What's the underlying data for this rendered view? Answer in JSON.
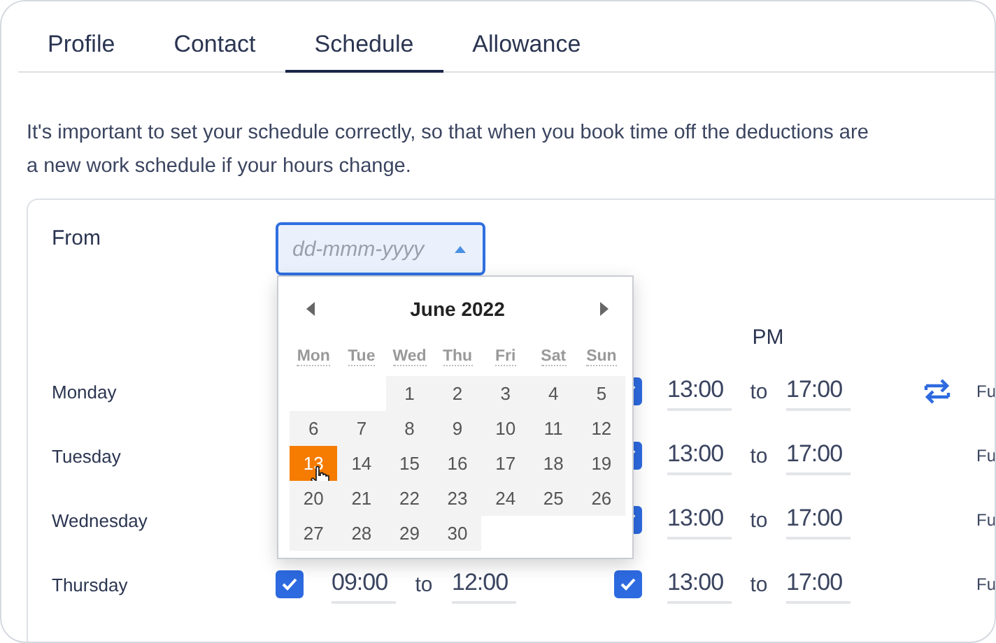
{
  "tabs": [
    {
      "label": "Profile",
      "selected": false
    },
    {
      "label": "Contact",
      "selected": false
    },
    {
      "label": "Schedule",
      "selected": true
    },
    {
      "label": "Allowance",
      "selected": false
    }
  ],
  "intro": [
    "It's important to set your schedule correctly, so that when you book time off the deductions are",
    "a new work schedule if your hours change."
  ],
  "from": {
    "label": "From",
    "placeholder": "dd-mmm-yyyy",
    "open": true
  },
  "pm_heading": "PM",
  "rows": [
    {
      "day": "Monday",
      "pm": {
        "checked": true,
        "from": "13:00",
        "sep": "to",
        "to": "17:00"
      },
      "repeat": true,
      "column_extra": "Fu"
    },
    {
      "day": "Tuesday",
      "pm": {
        "checked": true,
        "from": "13:00",
        "sep": "to",
        "to": "17:00"
      },
      "repeat": false,
      "column_extra": "Fu"
    },
    {
      "day": "Wednesday",
      "pm": {
        "checked": true,
        "from": "13:00",
        "sep": "to",
        "to": "17:00"
      },
      "repeat": false,
      "column_extra": "Fu"
    },
    {
      "day": "Thursday",
      "am": {
        "checked": true,
        "from": "09:00",
        "sep": "to",
        "to": "12:00"
      },
      "pm": {
        "checked": true,
        "from": "13:00",
        "sep": "to",
        "to": "17:00"
      },
      "repeat": false,
      "column_extra": "Fu"
    }
  ],
  "calendar": {
    "title": "June 2022",
    "weekdays": [
      "Mon",
      "Tue",
      "Wed",
      "Thu",
      "Fri",
      "Sat",
      "Sun"
    ],
    "days": [
      {
        "kind": "blank"
      },
      {
        "kind": "blank"
      },
      {
        "kind": "day",
        "label": "1",
        "selected": false
      },
      {
        "kind": "day",
        "label": "2",
        "selected": false
      },
      {
        "kind": "day",
        "label": "3",
        "selected": false
      },
      {
        "kind": "day",
        "label": "4",
        "selected": false
      },
      {
        "kind": "day",
        "label": "5",
        "selected": false
      },
      {
        "kind": "day",
        "label": "6",
        "selected": false
      },
      {
        "kind": "day",
        "label": "7",
        "selected": false
      },
      {
        "kind": "day",
        "label": "8",
        "selected": false
      },
      {
        "kind": "day",
        "label": "9",
        "selected": false
      },
      {
        "kind": "day",
        "label": "10",
        "selected": false
      },
      {
        "kind": "day",
        "label": "11",
        "selected": false
      },
      {
        "kind": "day",
        "label": "12",
        "selected": false
      },
      {
        "kind": "day",
        "label": "13",
        "selected": true
      },
      {
        "kind": "day",
        "label": "14",
        "selected": false
      },
      {
        "kind": "day",
        "label": "15",
        "selected": false
      },
      {
        "kind": "day",
        "label": "16",
        "selected": false
      },
      {
        "kind": "day",
        "label": "17",
        "selected": false
      },
      {
        "kind": "day",
        "label": "18",
        "selected": false
      },
      {
        "kind": "day",
        "label": "19",
        "selected": false
      },
      {
        "kind": "day",
        "label": "20",
        "selected": false
      },
      {
        "kind": "day",
        "label": "21",
        "selected": false
      },
      {
        "kind": "day",
        "label": "22",
        "selected": false
      },
      {
        "kind": "day",
        "label": "23",
        "selected": false
      },
      {
        "kind": "day",
        "label": "24",
        "selected": false
      },
      {
        "kind": "day",
        "label": "25",
        "selected": false
      },
      {
        "kind": "day",
        "label": "26",
        "selected": false
      },
      {
        "kind": "day",
        "label": "27",
        "selected": false
      },
      {
        "kind": "day",
        "label": "28",
        "selected": false
      },
      {
        "kind": "day",
        "label": "29",
        "selected": false
      },
      {
        "kind": "day",
        "label": "30",
        "selected": false
      }
    ]
  }
}
